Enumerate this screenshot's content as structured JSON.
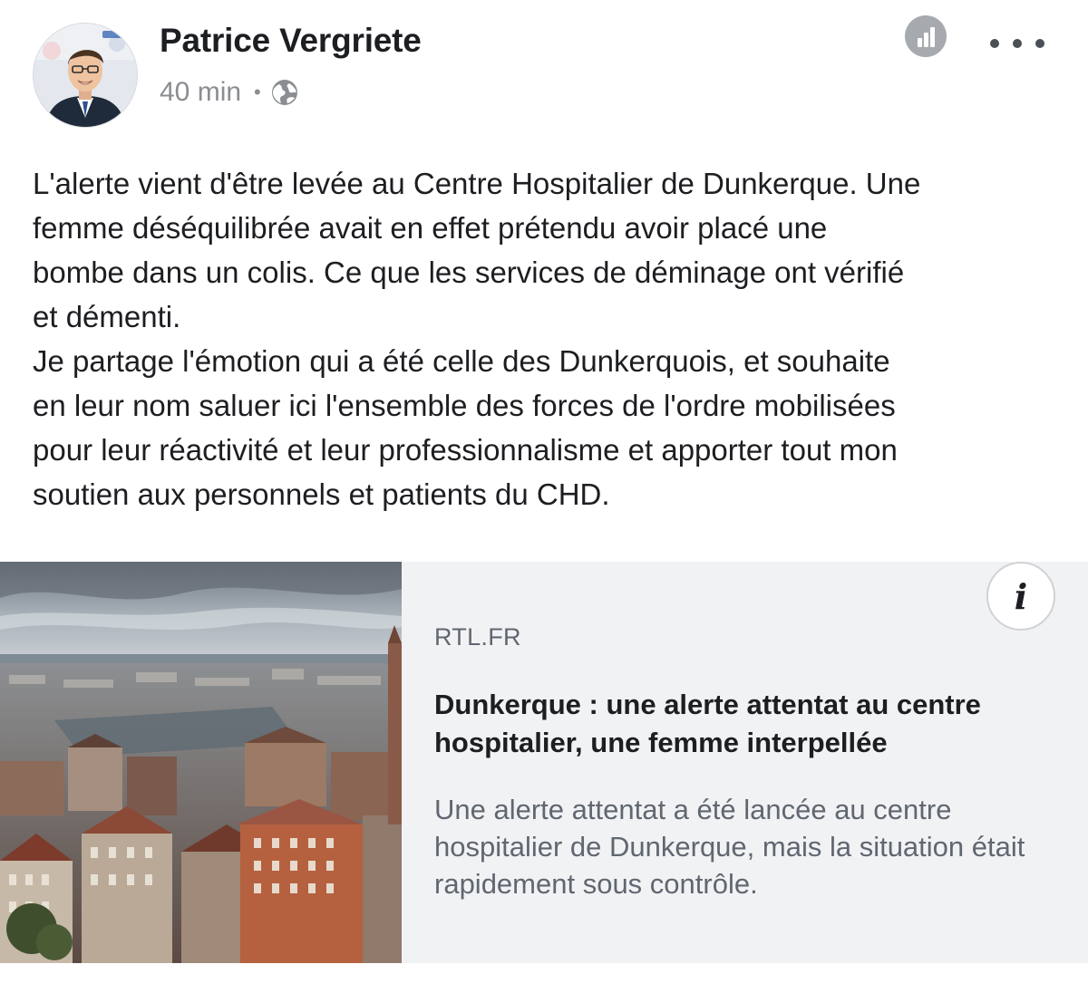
{
  "post": {
    "author": "Patrice Vergriete",
    "timestamp": "40 min",
    "separator": "•",
    "privacy_icon": "globe-icon",
    "stats_icon": "bar-chart-icon",
    "more_icon": "more-options-icon",
    "text_lines": [
      "L'alerte vient d'être levée au Centre Hospitalier de Dunkerque. Une",
      "femme déséquilibrée avait en effet prétendu avoir placé une",
      "bombe dans un colis. Ce que les services de déminage ont vérifié",
      "et démenti.",
      "Je partage l'émotion qui a été celle des Dunkerquois, et souhaite",
      "en leur nom saluer ici l'ensemble des forces de l'ordre mobilisées",
      "pour leur réactivité et leur professionnalisme et apporter tout mon",
      "soutien aux personnels et patients du CHD."
    ]
  },
  "link": {
    "domain": "RTL.FR",
    "title": "Dunkerque : une alerte attentat au centre hospitalier, une femme interpellée",
    "description": "Une alerte attentat a été lancée au centre hospitalier de Dunkerque, mais la situation était rapidement sous contrôle.",
    "info_label": "i",
    "info_icon": "info-icon"
  },
  "colors": {
    "text": "#1c1e21",
    "secondary_text": "#606770",
    "meta_text": "#8a8d91",
    "card_background": "#f1f2f4"
  }
}
